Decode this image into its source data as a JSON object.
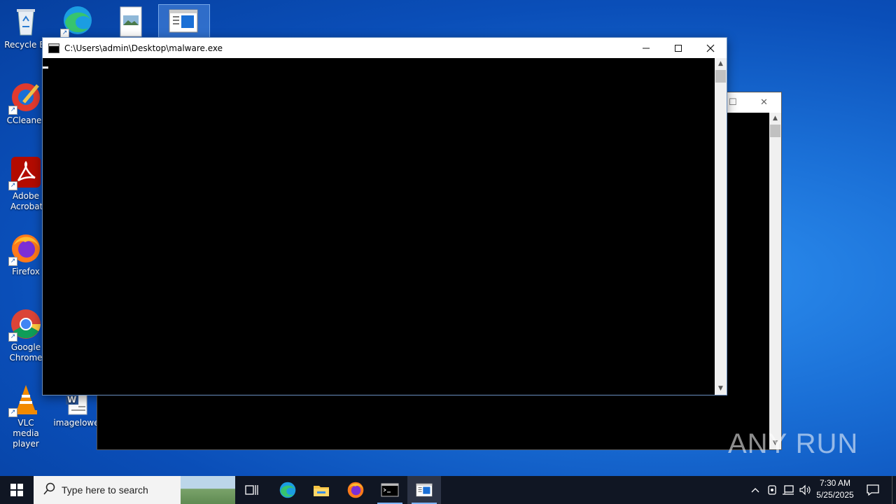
{
  "desktop": {
    "icons": [
      {
        "label": "Recycle Bi",
        "icon": "recycle-bin-icon"
      },
      {
        "label": "",
        "icon": "edge-icon"
      },
      {
        "label": "",
        "icon": "image-file-icon"
      },
      {
        "label": "",
        "icon": "document-window-icon"
      },
      {
        "label": "CCleaner",
        "icon": "ccleaner-icon"
      },
      {
        "label": "Adobe Acrobat",
        "icon": "acrobat-icon"
      },
      {
        "label": "Firefox",
        "icon": "firefox-icon"
      },
      {
        "label": "Google Chrome",
        "icon": "chrome-icon"
      },
      {
        "label": "VLC media player",
        "icon": "vlc-icon"
      },
      {
        "label": "imagelowe",
        "icon": "word-doc-icon"
      }
    ]
  },
  "window": {
    "title": "C:\\Users\\admin\\Desktop\\malware.exe",
    "controls": {
      "minimize": "minimize",
      "maximize": "maximize",
      "close": "close"
    }
  },
  "watermark": "ANY RUN",
  "taskbar": {
    "search_placeholder": "Type here to search",
    "apps": [
      "task-view",
      "edge",
      "file-explorer",
      "firefox",
      "console",
      "document-window"
    ],
    "clock": {
      "time": "7:30 AM",
      "date": "5/25/2025"
    }
  },
  "colors": {
    "desktop_bg": "#0a4eb8",
    "taskbar_bg": "#101623",
    "console_bg": "#000000",
    "titlebar_bg": "#ffffff"
  }
}
